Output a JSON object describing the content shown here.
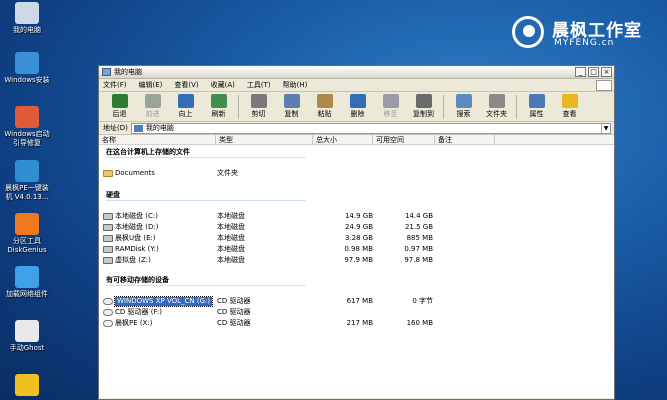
{
  "desktop": {
    "icons": [
      {
        "label": "我的电脑",
        "icon": "computer-icon",
        "color": "#cfd8e6"
      },
      {
        "label": "Windows安装",
        "icon": "windows-setup-icon",
        "color": "#3b8fd8"
      },
      {
        "label": "Windows启动\n引导修复",
        "icon": "boot-repair-icon",
        "color": "#e05a3a"
      },
      {
        "label": "晨枫PE一键装\n机 V4.0.13...",
        "icon": "installer-icon",
        "color": "#2f8fd0"
      },
      {
        "label": "分区工具\nDiskGenius",
        "icon": "diskgenius-icon",
        "color": "#f0781e"
      },
      {
        "label": "加载网络组件",
        "icon": "network-icon",
        "color": "#3fa0e8"
      },
      {
        "label": "手动Ghost",
        "icon": "ghost-icon",
        "color": "#e8e8e8"
      },
      {
        "label": "",
        "icon": "keys-icon",
        "color": "#f0c020"
      }
    ]
  },
  "brand": {
    "name": "晨枫工作室",
    "site": "MYFENG.cn"
  },
  "window": {
    "title": "我的电脑",
    "buttons": {
      "minimize": "_",
      "maximize": "□",
      "close": "×"
    },
    "menu": [
      "文件(F)",
      "编辑(E)",
      "查看(V)",
      "收藏(A)",
      "工具(T)",
      "帮助(H)"
    ],
    "toolbar": [
      {
        "label": "后退",
        "icon": "back-icon",
        "color": "#2e7d32",
        "enabled": true
      },
      {
        "label": "前进",
        "icon": "forward-icon",
        "color": "#9aa59a",
        "enabled": false
      },
      {
        "label": "向上",
        "icon": "up-icon",
        "color": "#2f6db8",
        "enabled": true
      },
      {
        "label": "刷新",
        "icon": "refresh-icon",
        "color": "#3f8f4f",
        "enabled": true
      },
      {
        "label": "剪切",
        "icon": "cut-icon",
        "color": "#7a7a7a",
        "enabled": true
      },
      {
        "label": "复制",
        "icon": "copy-icon",
        "color": "#5a7fb0",
        "enabled": true
      },
      {
        "label": "粘贴",
        "icon": "paste-icon",
        "color": "#b0884a",
        "enabled": true
      },
      {
        "label": "删除",
        "icon": "delete-icon",
        "color": "#2f6db8",
        "enabled": true
      },
      {
        "label": "移至",
        "icon": "move-icon",
        "color": "#9a9aa8",
        "enabled": false
      },
      {
        "label": "复制到",
        "icon": "copy-to-icon",
        "color": "#6a6a6a",
        "enabled": true
      },
      {
        "label": "搜索",
        "icon": "search-icon",
        "color": "#5a8ac0",
        "enabled": true
      },
      {
        "label": "文件夹",
        "icon": "folders-icon",
        "color": "#8a8a8a",
        "enabled": true
      },
      {
        "label": "属性",
        "icon": "properties-icon",
        "color": "#4a78b8",
        "enabled": true
      },
      {
        "label": "查看",
        "icon": "views-icon",
        "color": "#e8b820",
        "enabled": true
      }
    ],
    "address": {
      "label": "地址(D)",
      "value": "我的电脑"
    },
    "columns": [
      "名称",
      "类型",
      "总大小",
      "可用空间",
      "备注"
    ],
    "sections": [
      {
        "title": "在这台计算机上存储的文件",
        "items": [
          {
            "name": "Documents",
            "type": "文件夹",
            "size": "",
            "free": "",
            "kind": "folder"
          }
        ]
      },
      {
        "title": "硬盘",
        "items": [
          {
            "name": "本地磁盘 (C:)",
            "type": "本地磁盘",
            "size": "14.9 GB",
            "free": "14.4 GB",
            "kind": "disk"
          },
          {
            "name": "本地磁盘 (D:)",
            "type": "本地磁盘",
            "size": "24.9 GB",
            "free": "21.5 GB",
            "kind": "disk"
          },
          {
            "name": "晨枫U盘 (E:)",
            "type": "本地磁盘",
            "size": "3.28 GB",
            "free": "885 MB",
            "kind": "disk"
          },
          {
            "name": "RAMDisk (Y:)",
            "type": "本地磁盘",
            "size": "0.98 MB",
            "free": "0.97 MB",
            "kind": "disk"
          },
          {
            "name": "虚拟盘 (Z:)",
            "type": "本地磁盘",
            "size": "97.9 MB",
            "free": "97.8 MB",
            "kind": "disk"
          }
        ]
      },
      {
        "title": "有可移动存储的设备",
        "items": [
          {
            "name": "WINDOWS XP VOL_CN (G:)",
            "type": "CD 驱动器",
            "size": "617 MB",
            "free": "0 字节",
            "kind": "cd",
            "selected": true
          },
          {
            "name": "CD 驱动器 (F:)",
            "type": "CD 驱动器",
            "size": "",
            "free": "",
            "kind": "cd"
          },
          {
            "name": "晨枫PE (X:)",
            "type": "CD 驱动器",
            "size": "217 MB",
            "free": "160 MB",
            "kind": "cd"
          }
        ]
      }
    ]
  }
}
